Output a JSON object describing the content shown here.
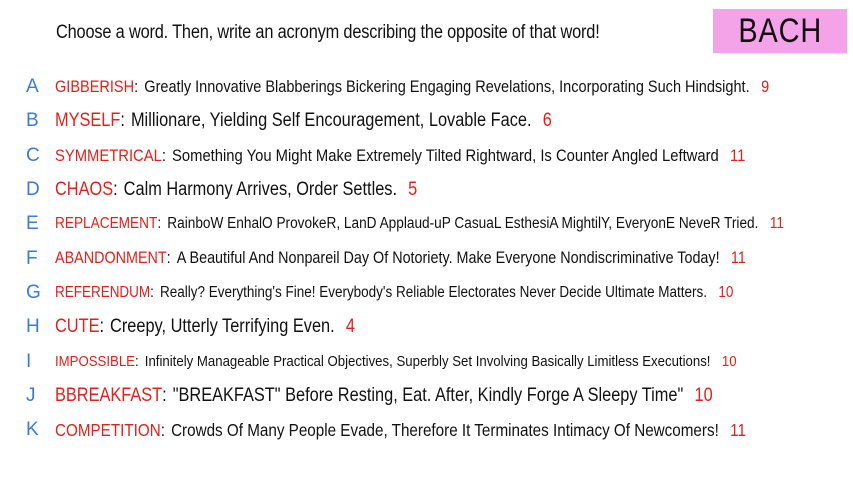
{
  "prompt": "Choose a word. Then, write an acronym describing the opposite of that word!",
  "badge": "BACH",
  "entries": [
    {
      "letter": "A",
      "word": "GIBBERISH",
      "acronym": "Greatly Innovative Blabberings Bickering Engaging Revelations, Incorporating Such Hindsight.",
      "count": "9"
    },
    {
      "letter": "B",
      "word": "MYSELF",
      "acronym": "Millionare, Yielding Self Encouragement, Lovable Face.",
      "count": "6"
    },
    {
      "letter": "C",
      "word": "SYMMETRICAL",
      "acronym": "Something You Might Make Extremely Tilted Rightward, Is Counter Angled Leftward",
      "count": "11"
    },
    {
      "letter": "D",
      "word": "CHAOS",
      "acronym": "Calm Harmony Arrives, Order Settles.",
      "count": "5"
    },
    {
      "letter": "E",
      "word": "REPLACEMENT",
      "acronym": "RainboW EnhalO ProvokeR, LanD Applaud-uP CasuaL EsthesiA MightilY, EveryonE NeveR Tried.",
      "count": "11"
    },
    {
      "letter": "F",
      "word": "ABANDONMENT",
      "acronym": "A Beautiful And Nonpareil Day Of Notoriety. Make Everyone Nondiscriminative Today!",
      "count": "11"
    },
    {
      "letter": "G",
      "word": "REFERENDUM",
      "acronym": "Really? Everything's Fine! Everybody's Reliable Electorates Never Decide Ultimate Matters.",
      "count": "10"
    },
    {
      "letter": "H",
      "word": "CUTE",
      "acronym": "Creepy, Utterly Terrifying Even.",
      "count": "4"
    },
    {
      "letter": "I",
      "word": "IMPOSSIBLE",
      "acronym": "Infinitely Manageable Practical Objectives, Superbly Set Involving Basically Limitless Executions!",
      "count": "10"
    },
    {
      "letter": "J",
      "word": "BBREAKFAST",
      "acronym": "\"BREAKFAST\" Before Resting, Eat. After, Kindly Forge A Sleepy Time\"",
      "count": "10"
    },
    {
      "letter": "K",
      "word": "COMPETITION",
      "acronym": "Crowds Of Many People Evade, Therefore It Terminates Intimacy Of Newcomers!",
      "count": "11"
    }
  ],
  "colors": {
    "letter": "#3a7bd5",
    "word": "#e3201b",
    "count": "#e3201b",
    "badge_bg": "#f4a3e8",
    "text": "#111111"
  }
}
